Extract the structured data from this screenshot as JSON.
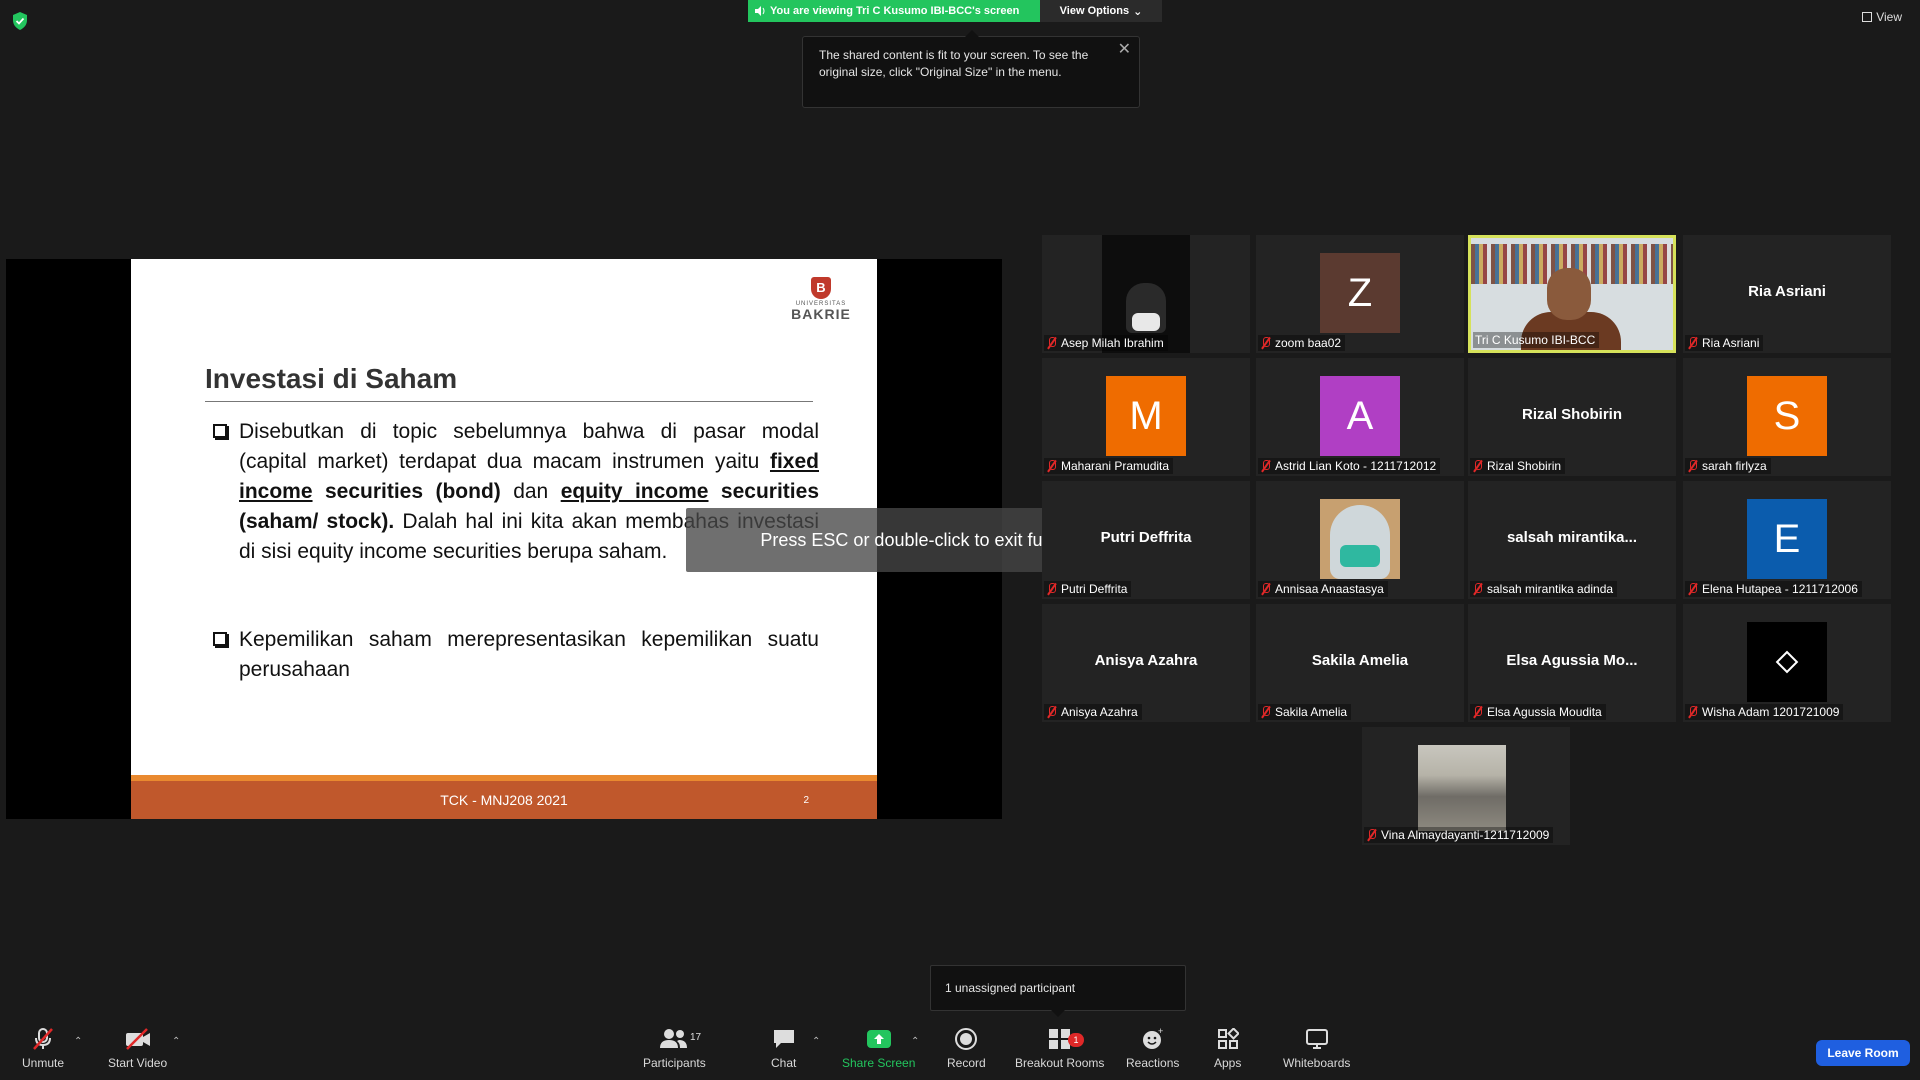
{
  "top": {
    "banner": "You are viewing Tri C Kusumo IBI-BCC's screen",
    "view_options": "View Options",
    "view": "View"
  },
  "tooltip": {
    "text": "The shared content is fit to your screen. To see the original size, click \"Original Size\" in the menu."
  },
  "slide": {
    "logo_small": "UNIVERSITAS",
    "logo_big": "BAKRIE",
    "title": "Investasi di Saham",
    "b1_p1": "Disebutkan di topic sebelumnya bahwa di  pasar modal (capital market)  terdapat dua macam instrumen yaitu ",
    "b1_fixed": "fixed income",
    "b1_p2": " securities (bond)",
    "b1_p3": " dan ",
    "b1_equity": "equity income",
    "b1_p4": " securities (saham/ stock).",
    "b1_p5": " Dalah hal ini kita akan membahas investasi di sisi equity income securities berupa saham.",
    "b2": "Kepemilikan  saham merepresentasikan kepemilikan suatu perusahaan",
    "footer": "TCK - MNJ208 2021",
    "page": "2"
  },
  "esc_message": "Press ESC or double-click to exit full screen mode",
  "participants": [
    {
      "name": "Asep Milah Ibrahim",
      "kind": "dark"
    },
    {
      "name": "zoom baa02",
      "kind": "avatar",
      "letter": "Z",
      "color": "#5b3a30"
    },
    {
      "name": "Tri C Kusumo IBI-BCC",
      "kind": "prof"
    },
    {
      "name": "Ria Asriani",
      "kind": "text",
      "big": "Ria Asriani"
    },
    {
      "name": "Maharani Pramudita",
      "kind": "avatar",
      "letter": "M",
      "color": "#ef6c00"
    },
    {
      "name": "Astrid Lian Koto - 1211712012",
      "kind": "avatar",
      "letter": "A",
      "color": "#b03fc4"
    },
    {
      "name": "Rizal Shobirin",
      "kind": "text",
      "big": "Rizal Shobirin"
    },
    {
      "name": "sarah firlyza",
      "kind": "avatar",
      "letter": "S",
      "color": "#ef6c00"
    },
    {
      "name": "Putri Deffrita",
      "kind": "text",
      "big": "Putri Deffrita"
    },
    {
      "name": "Annisaa Anaastasya",
      "kind": "selfie"
    },
    {
      "name": "salsah mirantika adinda",
      "kind": "text",
      "big": "salsah  mirantika..."
    },
    {
      "name": "Elena Hutapea - 1211712006",
      "kind": "avatar",
      "letter": "E",
      "color": "#0b5cad"
    },
    {
      "name": "Anisya Azahra",
      "kind": "text",
      "big": "Anisya Azahra"
    },
    {
      "name": "Sakila Amelia",
      "kind": "text",
      "big": "Sakila Amelia"
    },
    {
      "name": "Elsa Agussia Moudita",
      "kind": "text",
      "big": "Elsa  Agussia  Mo..."
    },
    {
      "name": "Wisha Adam 1201721009",
      "kind": "logo"
    },
    {
      "name": "Vina Almaydayanti-1211712009",
      "kind": "road"
    }
  ],
  "unassigned": "1 unassigned participant",
  "toolbar": {
    "unmute": "Unmute",
    "start_video": "Start Video",
    "participants": "Participants",
    "participants_count": "17",
    "chat": "Chat",
    "share_screen": "Share Screen",
    "record": "Record",
    "breakout_rooms": "Breakout Rooms",
    "breakout_badge": "1",
    "reactions": "Reactions",
    "apps": "Apps",
    "whiteboards": "Whiteboards",
    "leave": "Leave Room"
  },
  "colors": {
    "banner_green": "#23c55e",
    "active_speaker": "#d6e25a",
    "leave_blue": "#1f5fe0",
    "slide_footer": "#c0582c"
  }
}
